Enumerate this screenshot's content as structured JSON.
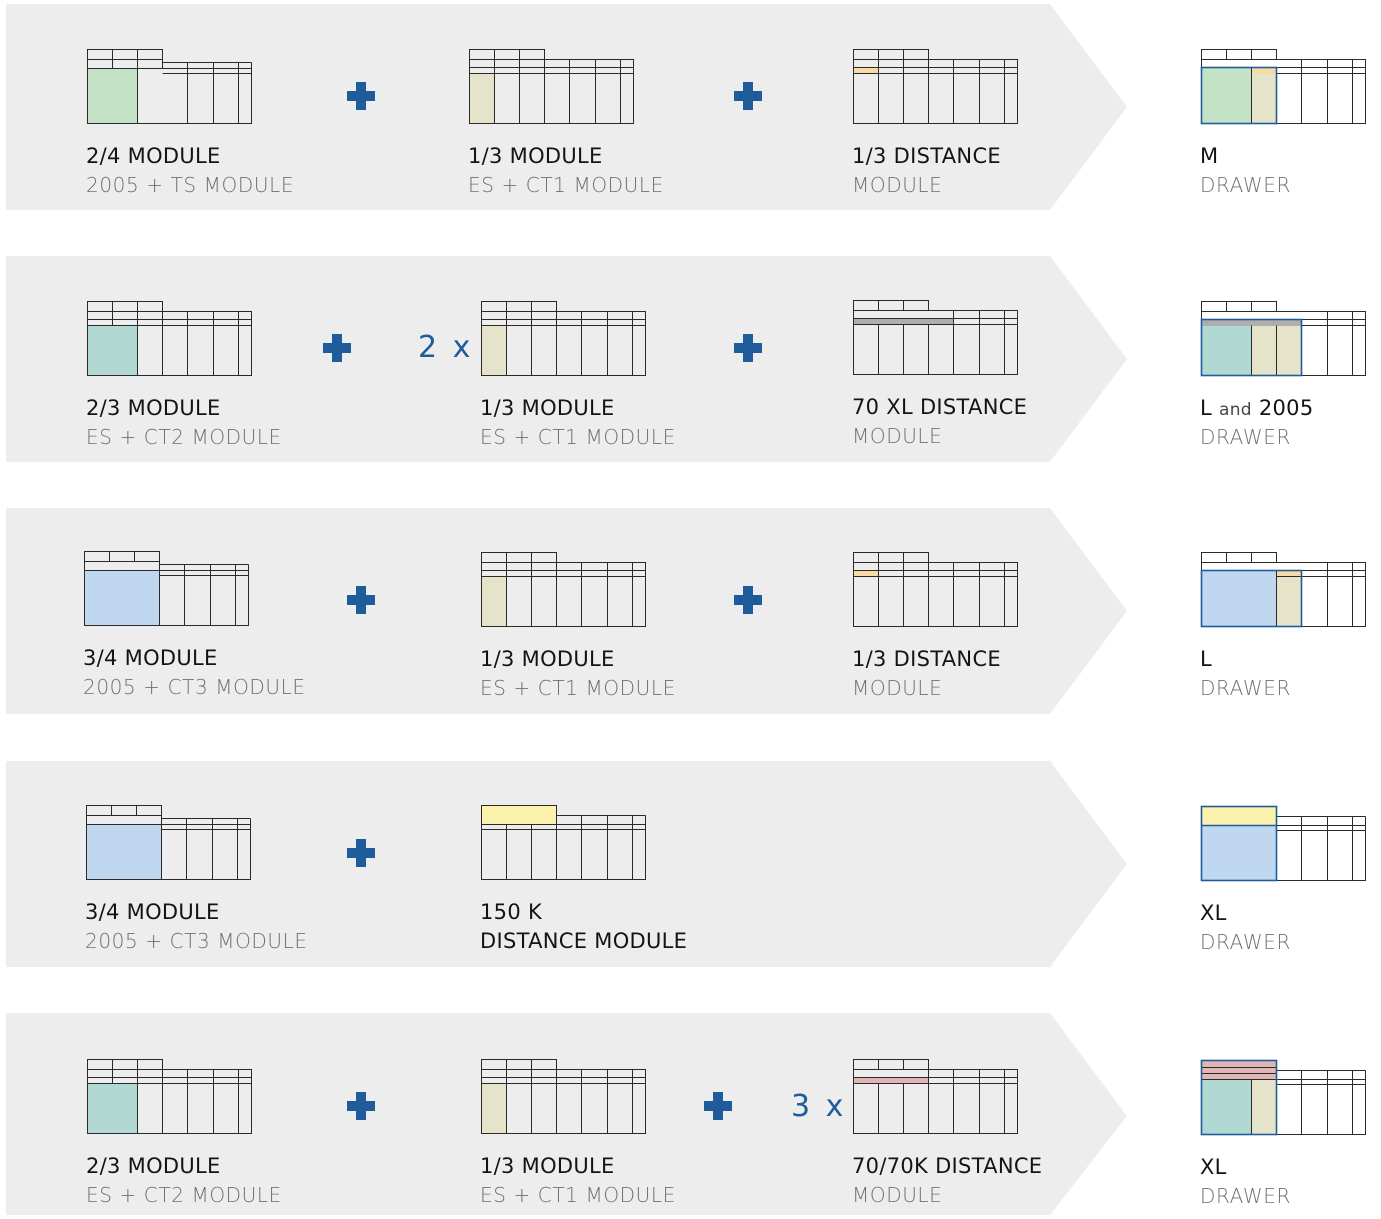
{
  "colors": {
    "band_bg": "#ededed",
    "plus": "#1e5c9c",
    "multiplier_text": "#1e5c9c",
    "drawer_outline": "#1e5c9c",
    "fill_green": "#c3e2c6",
    "fill_teal": "#b2d8d3",
    "fill_blue": "#bfd8ef",
    "fill_khaki": "#e5e4cb",
    "fill_orange": "#f9d9a6",
    "fill_gray": "#aeaeae",
    "fill_yellow": "#fbf2ad",
    "fill_pink": "#e0b7b5"
  },
  "icons": {
    "plus": "plus-icon",
    "band_arrow": "chevron-arrow-band"
  },
  "rows": [
    {
      "items": [
        {
          "line1": "2/4 MODULE",
          "line2": "2005 + TS MODULE"
        },
        {
          "line1": "1/3 MODULE",
          "line2": "ES + CT1 MODULE"
        },
        {
          "line1": "1/3 DISTANCE",
          "line2": "MODULE"
        }
      ],
      "multipliers": [],
      "result": {
        "line1": "M",
        "line2": "DRAWER"
      }
    },
    {
      "items": [
        {
          "line1": "2/3 MODULE",
          "line2": "ES + CT2 MODULE"
        },
        {
          "line1": "1/3 MODULE",
          "line2": "ES + CT1 MODULE"
        },
        {
          "line1": "70 XL DISTANCE",
          "line2": "MODULE"
        }
      ],
      "multipliers": [
        "2 x"
      ],
      "result": {
        "line1_a": "L",
        "line1_and": "and",
        "line1_b": "2005",
        "line2": "DRAWER"
      }
    },
    {
      "items": [
        {
          "line1": "3/4 MODULE",
          "line2": "2005 + CT3 MODULE"
        },
        {
          "line1": "1/3 MODULE",
          "line2": "ES + CT1 MODULE"
        },
        {
          "line1": "1/3 DISTANCE",
          "line2": "MODULE"
        }
      ],
      "multipliers": [],
      "result": {
        "line1": "L",
        "line2": "DRAWER"
      }
    },
    {
      "items": [
        {
          "line1": "3/4 MODULE",
          "line2": "2005 + CT3 MODULE"
        },
        {
          "line1": "150 K",
          "line2": "DISTANCE MODULE"
        }
      ],
      "multipliers": [],
      "result": {
        "line1": "XL",
        "line2": "DRAWER"
      }
    },
    {
      "items": [
        {
          "line1": "2/3 MODULE",
          "line2": "ES + CT2 MODULE"
        },
        {
          "line1": "1/3 MODULE",
          "line2": "ES + CT1 MODULE"
        },
        {
          "line1": "70/70K DISTANCE",
          "line2": "MODULE"
        }
      ],
      "multipliers": [
        "3 x"
      ],
      "result": {
        "line1": "XL",
        "line2": "DRAWER"
      }
    }
  ]
}
